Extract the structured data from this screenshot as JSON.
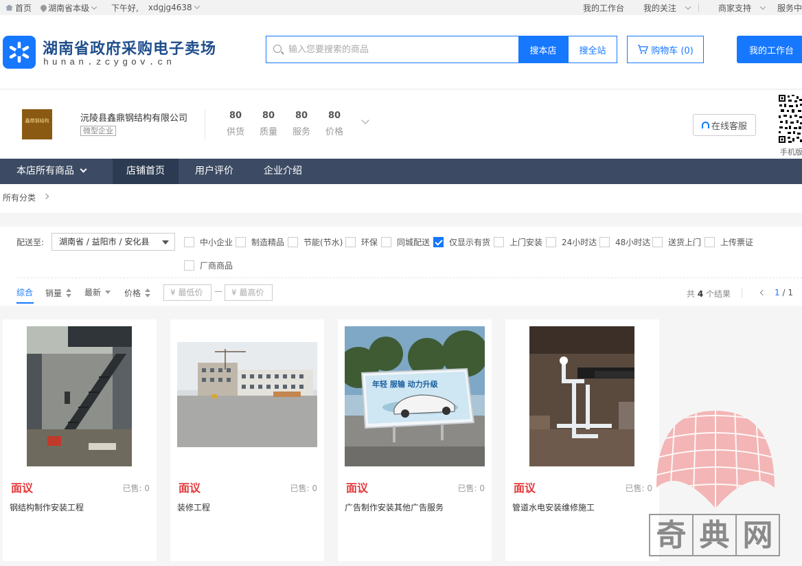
{
  "topbar": {
    "home": "首页",
    "region": "湖南省本级",
    "greeting": "下午好,",
    "username": "xdgjg4638",
    "right_links": [
      "我的工作台",
      "我的关注",
      "商家支持",
      "服务中"
    ]
  },
  "header": {
    "site_title": "湖南省政府采购电子卖场",
    "site_domain": "hunan.zcygov.cn",
    "search_placeholder": "输入您要搜索的商品",
    "search_store_label": "搜本店",
    "search_all_label": "搜全站",
    "cart_label": "购物车 (0)",
    "workbench_label": "我的工作台"
  },
  "shop": {
    "logo_text": "鑫鼎钢结构",
    "name": "沅陵县鑫鼎钢结构有限公司",
    "tag": "微型企业",
    "scores": [
      {
        "value": "80",
        "label": "供货"
      },
      {
        "value": "80",
        "label": "质量"
      },
      {
        "value": "80",
        "label": "服务"
      },
      {
        "value": "80",
        "label": "价格"
      }
    ],
    "service_label": "在线客服",
    "qr_label": "手机版"
  },
  "nav": {
    "items": [
      "本店所有商品",
      "店铺首页",
      "用户评价",
      "企业介绍"
    ],
    "active_index": 1
  },
  "breadcrumb": {
    "root": "所有分类"
  },
  "filter": {
    "ship_label": "配送至:",
    "ship_value": "湖南省 / 益阳市 / 安化县",
    "checkboxes": [
      {
        "label": "中小企业",
        "checked": false
      },
      {
        "label": "制造精品",
        "checked": false
      },
      {
        "label": "节能(节水)",
        "checked": false
      },
      {
        "label": "环保",
        "checked": false
      },
      {
        "label": "同城配送",
        "checked": false
      },
      {
        "label": "仅显示有货",
        "checked": true
      },
      {
        "label": "上门安装",
        "checked": false
      },
      {
        "label": "24小时达",
        "checked": false
      },
      {
        "label": "48小时达",
        "checked": false
      },
      {
        "label": "送货上门",
        "checked": false
      },
      {
        "label": "上传票证",
        "checked": false
      },
      {
        "label": "厂商商品",
        "checked": false
      }
    ],
    "sort": [
      "综合",
      "销量",
      "最新",
      "价格"
    ],
    "price_min_placeholder": "¥ 最低价",
    "price_max_placeholder": "¥ 最高价",
    "price_dash": "—",
    "result_prefix": "共",
    "result_count": "4",
    "result_suffix": "个结果",
    "page_current": "1",
    "page_total": "/ 1"
  },
  "products": [
    {
      "price": "面议",
      "sold": "已售: 0",
      "title": "钢结构制作安装工程"
    },
    {
      "price": "面议",
      "sold": "已售: 0",
      "title": "装修工程"
    },
    {
      "price": "面议",
      "sold": "已售: 0",
      "title": "广告制作安装其他广告服务"
    },
    {
      "price": "面议",
      "sold": "已售: 0",
      "title": "管道水电安装维修施工"
    }
  ],
  "ad_board_text": "年轻 服输 动力升级",
  "watermark": {
    "chars": [
      "奇",
      "典",
      "网"
    ]
  },
  "colors": {
    "brand": "#1677ff",
    "nav_bg": "#3c4b63",
    "price_red": "#e4393c"
  }
}
